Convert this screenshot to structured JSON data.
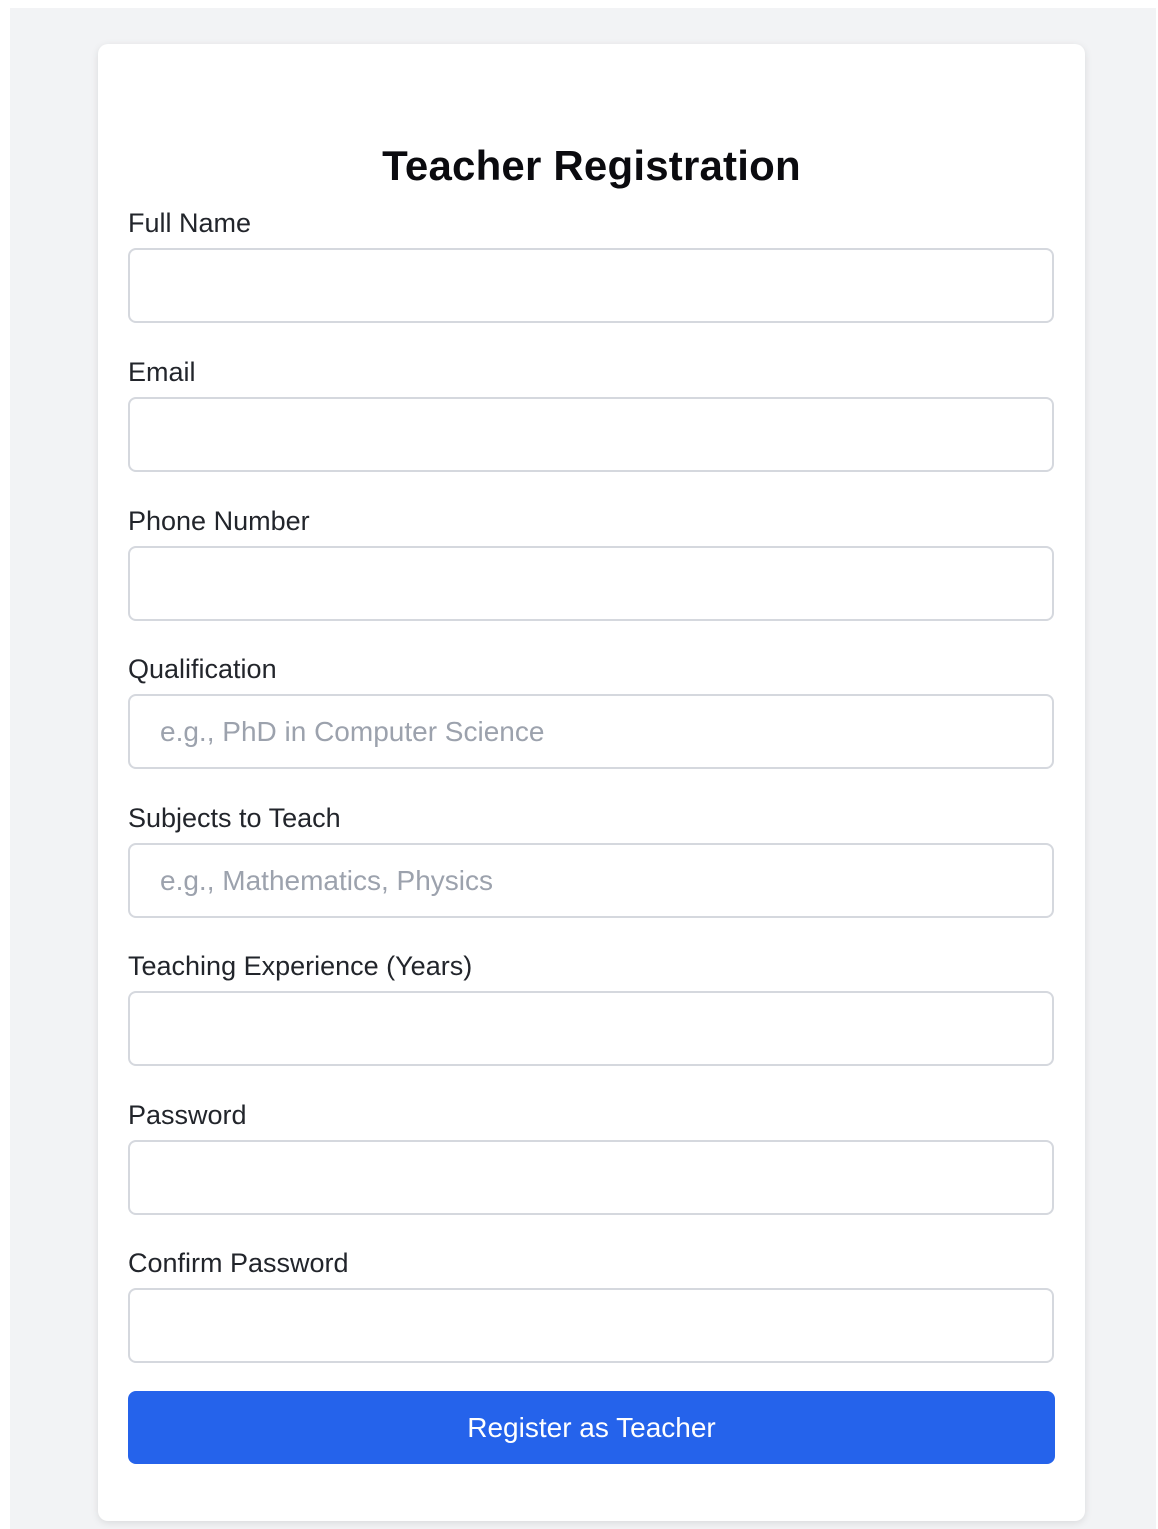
{
  "form": {
    "title": "Teacher Registration",
    "fields": [
      {
        "label": "Full Name",
        "value": "",
        "placeholder": ""
      },
      {
        "label": "Email",
        "value": "",
        "placeholder": ""
      },
      {
        "label": "Phone Number",
        "value": "",
        "placeholder": ""
      },
      {
        "label": "Qualification",
        "value": "",
        "placeholder": "e.g., PhD in Computer Science"
      },
      {
        "label": "Subjects to Teach",
        "value": "",
        "placeholder": "e.g., Mathematics, Physics"
      },
      {
        "label": "Teaching Experience (Years)",
        "value": "",
        "placeholder": ""
      },
      {
        "label": "Password",
        "value": "",
        "placeholder": ""
      },
      {
        "label": "Confirm Password",
        "value": "",
        "placeholder": ""
      }
    ],
    "submit_label": "Register as Teacher"
  },
  "colors": {
    "page_background": "#f2f3f5",
    "card_background": "#ffffff",
    "accent": "#2563eb",
    "input_border": "#d5d8de",
    "placeholder": "#9ca2ad"
  }
}
